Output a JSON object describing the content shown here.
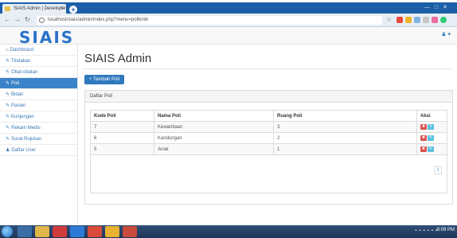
{
  "browser": {
    "tab_title": "SIAIS Admin | Developer",
    "tab_close": "×",
    "new_tab": "+",
    "url": "localhost/siais/admin/index.php?menu=polikinik"
  },
  "app": {
    "logo": "SIAIS",
    "user_menu": "♟ ▾"
  },
  "sidebar": {
    "items": [
      {
        "label": "Dashboard",
        "icon": "home-icon",
        "glyph": "⌂",
        "active": false
      },
      {
        "label": "Tindakan",
        "icon": "wrench-icon",
        "glyph": "✎",
        "active": false
      },
      {
        "label": "Obat-obatan",
        "icon": "wrench-icon",
        "glyph": "✎",
        "active": false
      },
      {
        "label": "Poli",
        "icon": "wrench-icon",
        "glyph": "✎",
        "active": true
      },
      {
        "label": "Bidan",
        "icon": "wrench-icon",
        "glyph": "✎",
        "active": false
      },
      {
        "label": "Pasien",
        "icon": "wrench-icon",
        "glyph": "✎",
        "active": false
      },
      {
        "label": "Kunjungan",
        "icon": "wrench-icon",
        "glyph": "✎",
        "active": false
      },
      {
        "label": "Rekam Medis",
        "icon": "wrench-icon",
        "glyph": "✎",
        "active": false
      },
      {
        "label": "Surat Rujukan",
        "icon": "wrench-icon",
        "glyph": "✎",
        "active": false
      },
      {
        "label": "Daftar User",
        "icon": "user-icon",
        "glyph": "♟",
        "active": false
      }
    ]
  },
  "main": {
    "title": "SIAIS Admin",
    "add_button": "+ Tambah Poli",
    "panel_title": "Daftar Poli",
    "table": {
      "columns": [
        "Kode Poli",
        "Nama Poli",
        "Ruang Poli",
        "Aksi"
      ],
      "rows": [
        [
          "7",
          "Kewanitaan",
          "3"
        ],
        [
          "6",
          "Kandungan",
          "2"
        ],
        [
          "5",
          "Anak",
          "1"
        ]
      ]
    },
    "pager": "1"
  },
  "taskbar": {
    "clock": "8:09 PM"
  },
  "colors": {
    "primary": "#2f79be",
    "sidebar_active": "#3a83c8",
    "delete": "#d9534f",
    "edit": "#5bc0de",
    "logo": "#2a72c9"
  }
}
